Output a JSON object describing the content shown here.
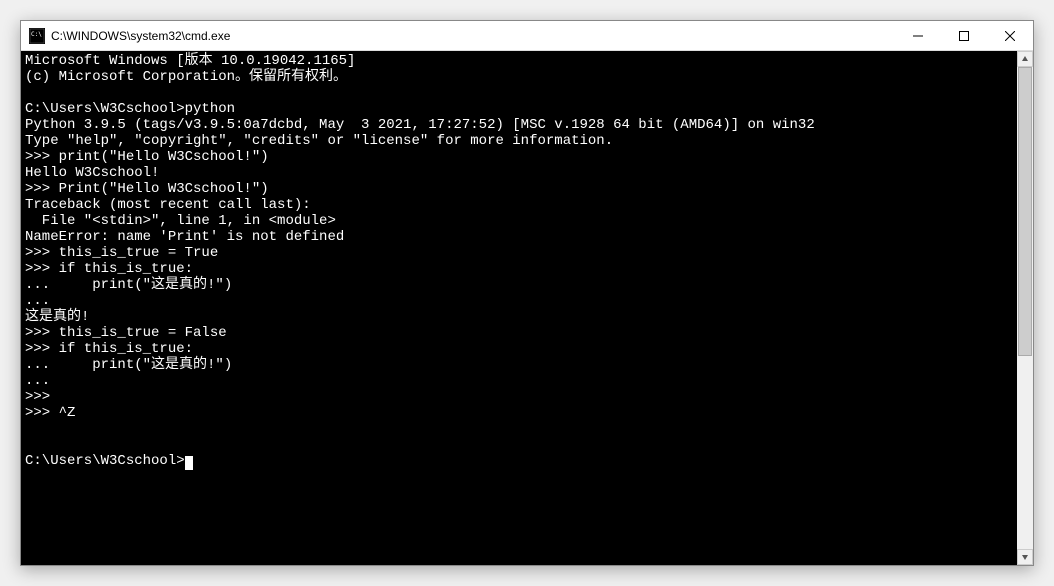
{
  "window": {
    "title": "C:\\WINDOWS\\system32\\cmd.exe"
  },
  "terminal": {
    "lines": [
      "Microsoft Windows [版本 10.0.19042.1165]",
      "(c) Microsoft Corporation。保留所有权利。",
      "",
      "C:\\Users\\W3Cschool>python",
      "Python 3.9.5 (tags/v3.9.5:0a7dcbd, May  3 2021, 17:27:52) [MSC v.1928 64 bit (AMD64)] on win32",
      "Type \"help\", \"copyright\", \"credits\" or \"license\" for more information.",
      ">>> print(\"Hello W3Cschool!\")",
      "Hello W3Cschool!",
      ">>> Print(\"Hello W3Cschool!\")",
      "Traceback (most recent call last):",
      "  File \"<stdin>\", line 1, in <module>",
      "NameError: name 'Print' is not defined",
      ">>> this_is_true = True",
      ">>> if this_is_true:",
      "...     print(\"这是真的!\")",
      "...",
      "这是真的!",
      ">>> this_is_true = False",
      ">>> if this_is_true:",
      "...     print(\"这是真的!\")",
      "...",
      ">>>",
      ">>> ^Z",
      "",
      "",
      "C:\\Users\\W3Cschool>"
    ]
  }
}
